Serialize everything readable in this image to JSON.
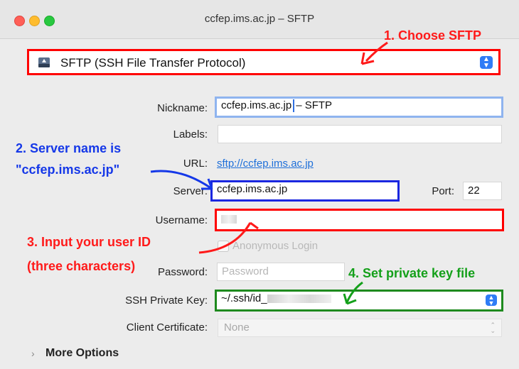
{
  "window": {
    "title": "ccfep.ims.ac.jp – SFTP"
  },
  "protocol": {
    "label": "SFTP (SSH File Transfer Protocol)"
  },
  "form": {
    "nickname_label": "Nickname:",
    "nickname_before_caret": "ccfep.ims.ac.jp",
    "nickname_after_caret": "– SFTP",
    "labels_label": "Labels:",
    "url_label": "URL:",
    "url_value": "sftp://ccfep.ims.ac.jp",
    "server_label": "Server:",
    "server_value": "ccfep.ims.ac.jp",
    "port_label": "Port:",
    "port_value": "22",
    "username_label": "Username:",
    "anonymous_label": "Anonymous Login",
    "password_label": "Password:",
    "password_placeholder": "Password",
    "ssh_key_label": "SSH Private Key:",
    "ssh_key_value": "~/.ssh/id_",
    "client_cert_label": "Client Certificate:",
    "client_cert_value": "None",
    "more_options_label": "More Options"
  },
  "annotations": {
    "step1": "1. Choose SFTP",
    "step2_line1": "2. Server name is",
    "step2_line2": "\"ccfep.ims.ac.jp\"",
    "step3_line1": "3. Input your user ID",
    "step3_line2": "(three characters)",
    "step4": "4. Set private key file",
    "colors": {
      "red": "#ff1a1a",
      "blue": "#1538e8",
      "green": "#14a01a"
    }
  },
  "icons": {
    "protocol": "drive-icon",
    "expand": "chevron-right-icon",
    "stepper": "updown-arrows-icon"
  }
}
